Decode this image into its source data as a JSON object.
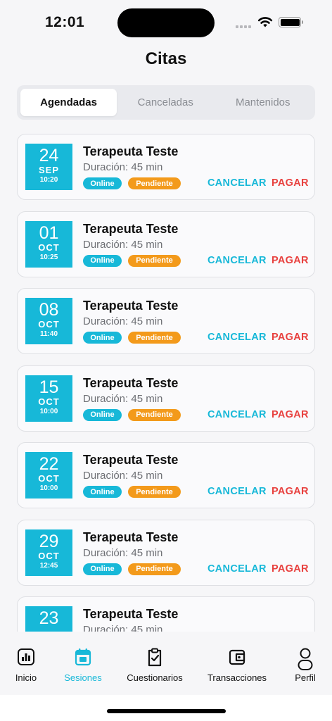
{
  "status": {
    "time": "12:01"
  },
  "header": {
    "title": "Citas"
  },
  "tabs": [
    {
      "label": "Agendadas",
      "active": true
    },
    {
      "label": "Canceladas",
      "active": false
    },
    {
      "label": "Mantenidos",
      "active": false
    }
  ],
  "appointments": [
    {
      "day": "24",
      "month": "SEP",
      "time": "10:20",
      "therapist": "Terapeuta Teste",
      "duration": "Duración: 45 min",
      "mode": "Online",
      "status": "Pendiente",
      "cancel_label": "CANCELAR",
      "pay_label": "PAGAR"
    },
    {
      "day": "01",
      "month": "OCT",
      "time": "10:25",
      "therapist": "Terapeuta Teste",
      "duration": "Duración: 45 min",
      "mode": "Online",
      "status": "Pendiente",
      "cancel_label": "CANCELAR",
      "pay_label": "PAGAR"
    },
    {
      "day": "08",
      "month": "OCT",
      "time": "11:40",
      "therapist": "Terapeuta Teste",
      "duration": "Duración: 45 min",
      "mode": "Online",
      "status": "Pendiente",
      "cancel_label": "CANCELAR",
      "pay_label": "PAGAR"
    },
    {
      "day": "15",
      "month": "OCT",
      "time": "10:00",
      "therapist": "Terapeuta Teste",
      "duration": "Duración: 45 min",
      "mode": "Online",
      "status": "Pendiente",
      "cancel_label": "CANCELAR",
      "pay_label": "PAGAR"
    },
    {
      "day": "22",
      "month": "OCT",
      "time": "10:00",
      "therapist": "Terapeuta Teste",
      "duration": "Duración: 45 min",
      "mode": "Online",
      "status": "Pendiente",
      "cancel_label": "CANCELAR",
      "pay_label": "PAGAR"
    },
    {
      "day": "29",
      "month": "OCT",
      "time": "12:45",
      "therapist": "Terapeuta Teste",
      "duration": "Duración: 45 min",
      "mode": "Online",
      "status": "Pendiente",
      "cancel_label": "CANCELAR",
      "pay_label": "PAGAR"
    },
    {
      "day": "23",
      "month": "",
      "time": "",
      "therapist": "Terapeuta Teste",
      "duration": "Duración: 45 min",
      "mode": "",
      "status": "",
      "cancel_label": "",
      "pay_label": ""
    }
  ],
  "tabbar": [
    {
      "label": "Inicio",
      "icon": "chart-icon",
      "active": false
    },
    {
      "label": "Sesiones",
      "icon": "calendar-icon",
      "active": true
    },
    {
      "label": "Cuestionarios",
      "icon": "clipboard-check-icon",
      "active": false
    },
    {
      "label": "Transacciones",
      "icon": "wallet-icon",
      "active": false
    },
    {
      "label": "Perfil",
      "icon": "user-icon",
      "active": false
    }
  ],
  "colors": {
    "accent": "#17b8d8",
    "pending": "#f39a1b",
    "pay": "#e8413f"
  }
}
